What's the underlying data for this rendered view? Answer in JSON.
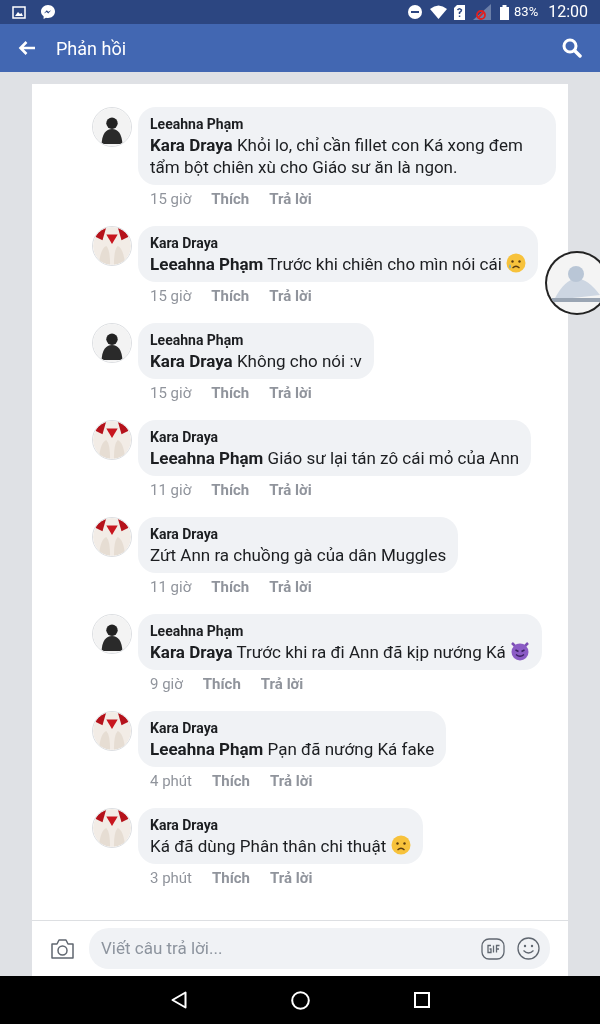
{
  "status_bar": {
    "battery": "83%",
    "time": "12:00"
  },
  "header": {
    "title": "Phản hồi"
  },
  "comments": [
    {
      "author": "Leeahna Phạm",
      "avatar": {
        "kind": "dark"
      },
      "text": "**Kara Draya** Khỏi lo, chỉ cần fillet con Ká xong đem tẩm bột chiên xù cho Giáo sư ăn là ngon.",
      "time": "15 giờ",
      "like": "Thích",
      "reply": "Trả lời"
    },
    {
      "author": "Kara Draya",
      "avatar": {
        "kind": "red"
      },
      "text": "**Leeahna Phạm** Trước khi chiên cho mìn nói cái",
      "emoji": {
        "kind": "crying"
      },
      "time": "15 giờ",
      "like": "Thích",
      "reply": "Trả lời"
    },
    {
      "author": "Leeahna Phạm",
      "avatar": {
        "kind": "dark"
      },
      "text": "**Kara Draya** Không cho nói :v",
      "time": "15 giờ",
      "like": "Thích",
      "reply": "Trả lời"
    },
    {
      "author": "Kara Draya",
      "avatar": {
        "kind": "red"
      },
      "text": "**Leeahna Phạm** Giáo sư lại tán zô cái mỏ của Ann",
      "time": "11 giờ",
      "like": "Thích",
      "reply": "Trả lời"
    },
    {
      "author": "Kara Draya",
      "avatar": {
        "kind": "red"
      },
      "text": "Zứt Ann ra chuồng gà của dân Muggles",
      "time": "11 giờ",
      "like": "Thích",
      "reply": "Trả lời"
    },
    {
      "author": "Leeahna Phạm",
      "avatar": {
        "kind": "dark"
      },
      "text": "**Kara Draya** Trước khi ra đi Ann đã kịp nướng Ká",
      "emoji": {
        "kind": "devil"
      },
      "time": "9 giờ",
      "like": "Thích",
      "reply": "Trả lời"
    },
    {
      "author": "Kara Draya",
      "avatar": {
        "kind": "red"
      },
      "text": "**Leeahna Phạm** Pạn đã nướng Ká fake",
      "time": "4 phút",
      "like": "Thích",
      "reply": "Trả lời"
    },
    {
      "author": "Kara Draya",
      "avatar": {
        "kind": "red"
      },
      "text": "Ká đã dùng Phân thân chi thuật",
      "emoji": {
        "kind": "frowning"
      },
      "time": "3 phút",
      "like": "Thích",
      "reply": "Trả lời"
    }
  ],
  "reply_box": {
    "placeholder": "Viết câu trả lời..."
  }
}
